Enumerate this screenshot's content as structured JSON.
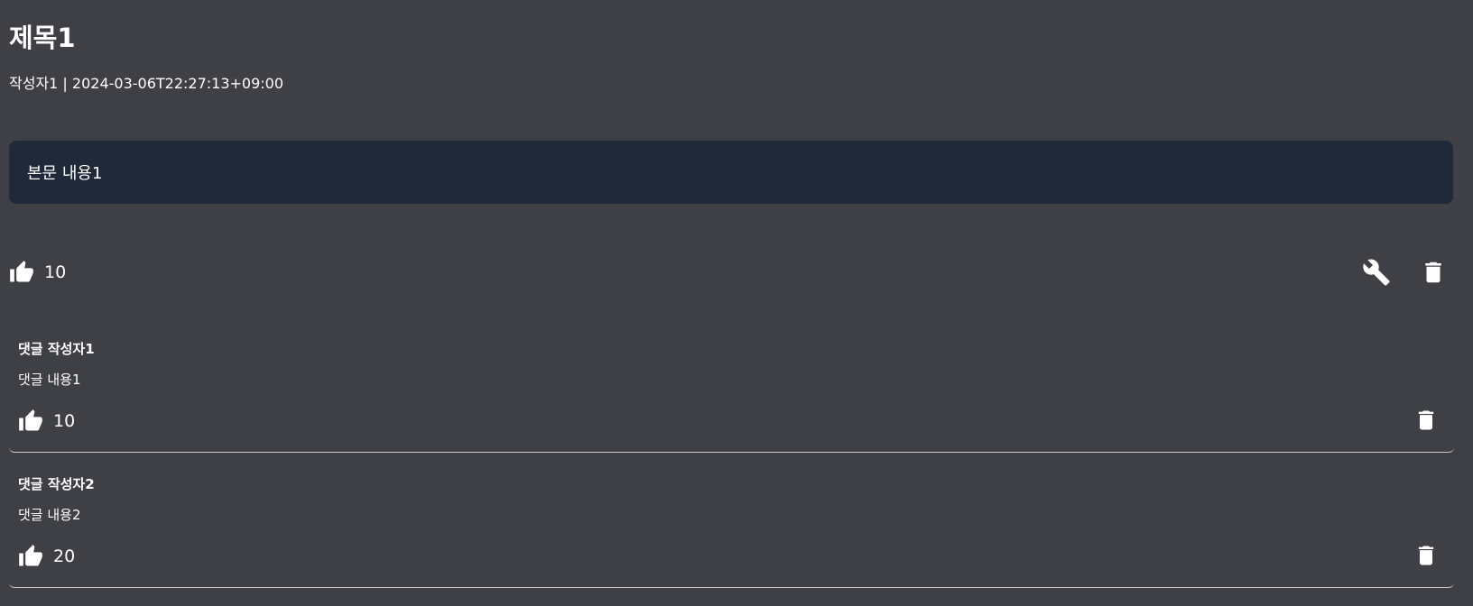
{
  "post": {
    "title": "제목1",
    "meta": "작성자1 | 2024-03-06T22:27:13+09:00",
    "body": "본문 내용1",
    "likes": "10"
  },
  "icons": {
    "like": "thumbs-up-icon",
    "edit": "wrench-icon",
    "delete": "trash-icon"
  },
  "comments": [
    {
      "author": "댓글 작성자1",
      "content": "댓글 내용1",
      "likes": "10"
    },
    {
      "author": "댓글 작성자2",
      "content": "댓글 내용2",
      "likes": "20"
    }
  ],
  "colors": {
    "background": "#3f4046",
    "body_box": "#1f293a",
    "text": "#ffffff"
  }
}
